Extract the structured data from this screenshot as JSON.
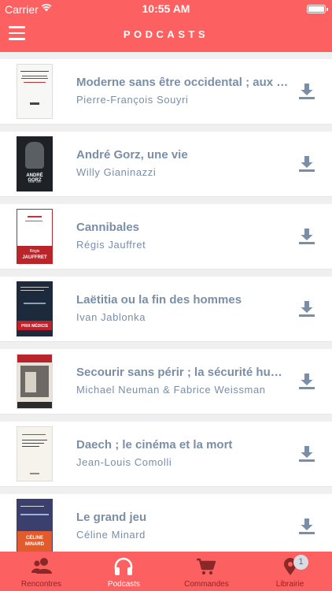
{
  "status_bar": {
    "carrier": "Carrier",
    "time": "10:55 AM"
  },
  "header": {
    "title": "PODCASTS",
    "menu_icon": "hamburger-icon",
    "background": "#fd6060"
  },
  "podcasts": [
    {
      "title": "Moderne sans être occidental ; aux origines du Japon",
      "author": "Pierre-François Souyri",
      "cover": "light"
    },
    {
      "title": "André Gorz, une vie",
      "author": "Willy Gianinazzi",
      "cover": "dark-photo"
    },
    {
      "title": "Cannibales",
      "author": "Régis Jauffret",
      "cover": "red-band"
    },
    {
      "title": "Laëtitia ou la fin des hommes",
      "author": "Ivan Jablonka",
      "cover": "navy-band"
    },
    {
      "title": "Secourir sans périr ; la sécurité humanitaire",
      "author": "Michael Neuman & Fabrice Weissman",
      "cover": "photo"
    },
    {
      "title": "Daech ; le cinéma et la mort",
      "author": "Jean-Louis Comolli",
      "cover": "plain"
    },
    {
      "title": "Le grand jeu",
      "author": "Céline Minard",
      "cover": "orange"
    }
  ],
  "download_icon": "download-icon",
  "tabbar": {
    "tabs": [
      {
        "label": "Rencontres",
        "icon": "people-icon",
        "active": false
      },
      {
        "label": "Podcasts",
        "icon": "headphones-icon",
        "active": true
      },
      {
        "label": "Commandes",
        "icon": "cart-icon",
        "active": false
      },
      {
        "label": "Librairie",
        "icon": "map-pin-icon",
        "active": false,
        "badge": "1"
      }
    ]
  },
  "colors": {
    "accent": "#fd6060",
    "text": "#7a8ea6",
    "inactive_tab": "#8a2727"
  }
}
